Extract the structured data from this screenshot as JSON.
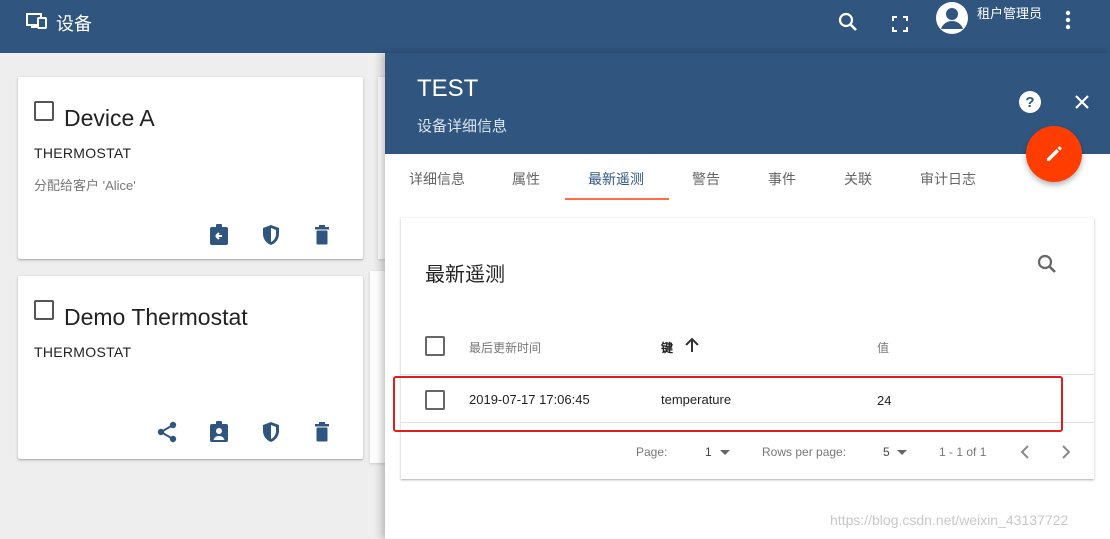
{
  "topbar": {
    "title": "设备",
    "title_icon": "devices-icon",
    "user_name": "租户管理员",
    "icons": [
      "search-icon",
      "fullscreen-icon",
      "account-icon",
      "more-vert-icon"
    ]
  },
  "devices": [
    {
      "name": "Device A",
      "type": "THERMOSTAT",
      "assigned": "分配给客户 'Alice'",
      "actions": [
        "assign-customer-icon",
        "credentials-icon",
        "delete-icon"
      ]
    },
    {
      "name": "Demo Thermostat",
      "type": "THERMOSTAT",
      "assigned": "",
      "actions": [
        "share-icon",
        "assign-customer-icon",
        "credentials-icon",
        "delete-icon"
      ]
    }
  ],
  "panel": {
    "title": "TEST",
    "subtitle": "设备详细信息",
    "help": "?",
    "tabs": [
      "详细信息",
      "属性",
      "最新遥测",
      "警告",
      "事件",
      "关联",
      "审计日志"
    ],
    "active_tab": "最新遥测"
  },
  "telemetry": {
    "title": "最新遥测",
    "columns": [
      "最后更新时间",
      "键",
      "值"
    ],
    "sort_column": "键",
    "rows": [
      {
        "time": "2019-07-17 17:06:45",
        "key": "temperature",
        "value": "24"
      }
    ],
    "page_label": "Page:",
    "page": "1",
    "rows_per_page_label": "Rows per page:",
    "rows_per_page": "5",
    "range": "1 - 1 of 1"
  },
  "watermark": "https://blog.csdn.net/weixin_43137722",
  "colors": {
    "primary": "#305680",
    "accent": "#ff3d00",
    "highlight": "#e21b1b"
  }
}
